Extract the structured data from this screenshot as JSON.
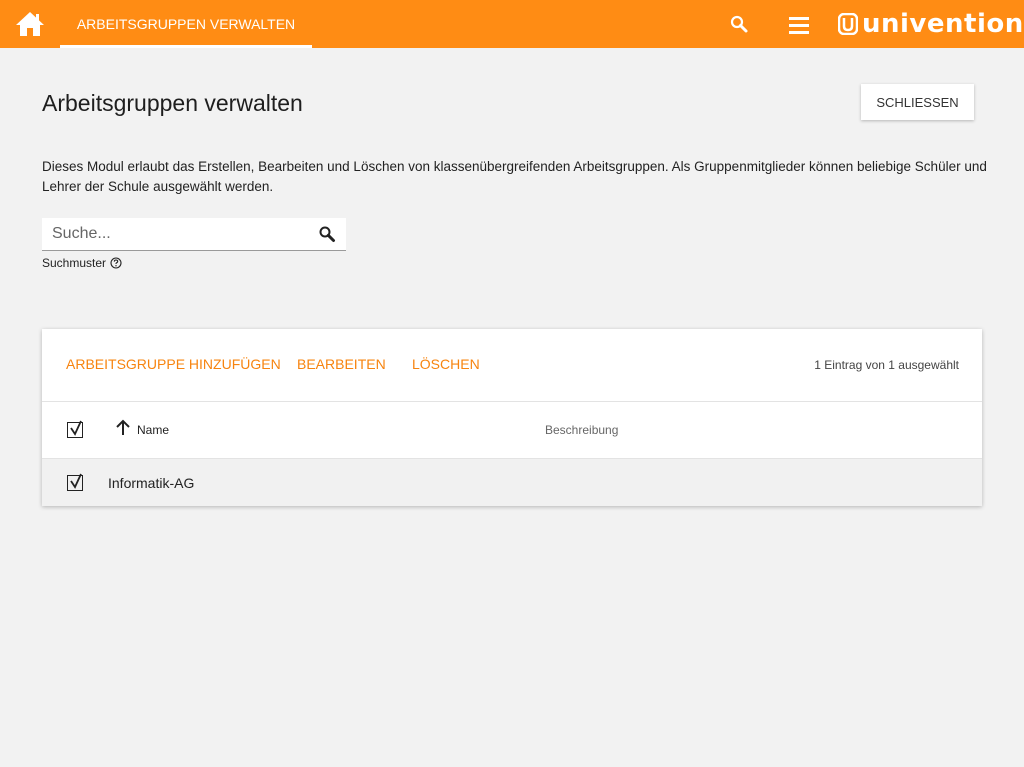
{
  "header": {
    "home_icon": "home-icon",
    "active_tab": "ARBEITSGRUPPEN VERWALTEN",
    "search_icon": "search-icon",
    "menu_icon": "hamburger-menu-icon",
    "logo_text": "univention"
  },
  "page": {
    "title": "Arbeitsgruppen verwalten",
    "close_label": "SCHLIESSEN",
    "description": "Dieses Modul erlaubt das Erstellen, Bearbeiten und Löschen von klassenübergreifenden Arbeitsgruppen. Als Gruppenmitglieder können beliebige Schüler und Lehrer der Schule ausgewählt werden."
  },
  "search": {
    "placeholder": "Suche...",
    "value": "",
    "pattern_label": "Suchmuster"
  },
  "grid": {
    "actions": {
      "add": "ARBEITSGRUPPE HINZUFÜGEN",
      "edit": "BEARBEITEN",
      "delete": "LÖSCHEN"
    },
    "selection_status": "1 Eintrag von 1 ausgewählt",
    "columns": [
      "Name",
      "Beschreibung"
    ],
    "rows": [
      {
        "name": "Informatik-AG",
        "description": "",
        "checked": true
      }
    ],
    "select_all_checked": true
  },
  "colors": {
    "brand": "#ff8c14",
    "action": "#f7840f",
    "background": "#f2f2f2"
  }
}
